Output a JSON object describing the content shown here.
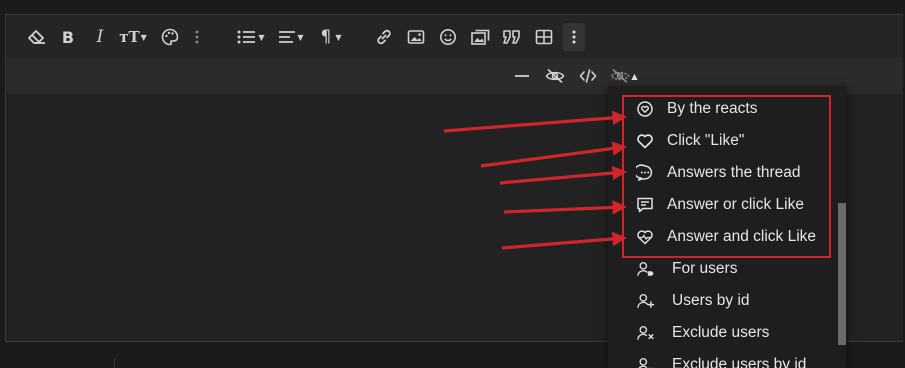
{
  "toolbar": {
    "row1": [
      {
        "name": "eraser-icon",
        "caret": false
      },
      {
        "name": "bold-icon",
        "glyph": "B",
        "caret": false
      },
      {
        "name": "italic-icon",
        "glyph": "I",
        "caret": false
      },
      {
        "name": "font-size-icon",
        "glyph": "тT",
        "caret": true
      },
      {
        "name": "palette-icon",
        "caret": false
      },
      {
        "name": "more-dots-icon",
        "caret": false
      },
      {
        "name": "list-icon",
        "caret": true
      },
      {
        "name": "align-icon",
        "caret": true
      },
      {
        "name": "paragraph-icon",
        "glyph": "¶",
        "caret": true
      },
      {
        "name": "link-icon",
        "caret": false
      },
      {
        "name": "image-icon",
        "caret": false
      },
      {
        "name": "smiley-icon",
        "caret": false
      },
      {
        "name": "gallery-icon",
        "caret": false
      },
      {
        "name": "quote-icon",
        "caret": false
      },
      {
        "name": "table-icon",
        "caret": false
      },
      {
        "name": "more-vertical-icon",
        "caret": false
      }
    ],
    "row2": [
      {
        "name": "horizontal-rule-icon"
      },
      {
        "name": "hide-icon"
      },
      {
        "name": "code-icon"
      },
      {
        "name": "hide-content-icon",
        "caret": true
      }
    ],
    "glyphs": {
      "bold": "B",
      "italic": "I",
      "font_size": "тT",
      "paragraph": "¶"
    }
  },
  "dropdown": {
    "highlighted_items": [
      {
        "label": "By the reacts",
        "icon": "heart-circle-icon"
      },
      {
        "label": "Click \"Like\"",
        "icon": "heart-icon"
      },
      {
        "label": "Answers the thread",
        "icon": "chat-bubble-dots-icon"
      },
      {
        "label": "Answer or click Like",
        "icon": "message-lines-icon"
      },
      {
        "label": "Answer and click Like",
        "icon": "heart-pulse-icon"
      }
    ],
    "other_items": [
      {
        "label": "For users",
        "icon": "user-tag-icon"
      },
      {
        "label": "Users by id",
        "icon": "user-plus-icon"
      },
      {
        "label": "Exclude users",
        "icon": "user-x-icon"
      },
      {
        "label": "Exclude users by id",
        "icon": "user-minus-icon"
      }
    ]
  },
  "annotation": {
    "highlight_color": "#d0262a",
    "arrow_color": "#d0262a"
  },
  "colors": {
    "background": "#1b1b1b",
    "editor": "#222222",
    "toolbar": "#252525",
    "text": "#e6e6e6"
  }
}
